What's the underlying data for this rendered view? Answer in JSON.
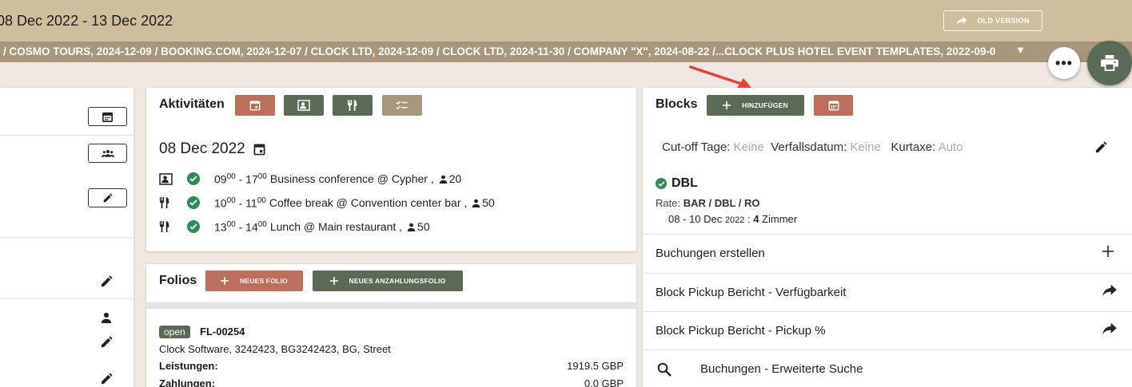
{
  "header": {
    "date_range": "08 Dec 2022 - 13 Dec 2022",
    "old_version_label": "OLD VERSION"
  },
  "breadcrumbs": "/  COSMO TOURS, 2024-12-09  /  BOOKING.COM, 2024-12-07  /  CLOCK LTD, 2024-12-09  /  CLOCK LTD, 2024-11-30  /  COMPANY \"X\", 2024-08-22  /...CLOCK PLUS HOTEL EVENT TEMPLATES, 2022-09-0",
  "fab": {
    "more_label": "•••"
  },
  "activities": {
    "title": "Aktivitäten",
    "date": "08 Dec 2022",
    "items": [
      {
        "kind_icon": "conference-icon",
        "start": "09",
        "start_min": "00",
        "end": "17",
        "end_min": "00",
        "text": "Business conference @ Cypher ,",
        "people": "20"
      },
      {
        "kind_icon": "restaurant-icon",
        "start": "10",
        "start_min": "00",
        "end": "11",
        "end_min": "00",
        "text": "Coffee break @ Convention center bar ,",
        "people": "50"
      },
      {
        "kind_icon": "restaurant-icon",
        "start": "13",
        "start_min": "00",
        "end": "14",
        "end_min": "00",
        "text": "Lunch @ Main restaurant ,",
        "people": "50"
      }
    ]
  },
  "folios": {
    "title": "Folios",
    "new_folio_label": "NEUES FOLIO",
    "new_deposit_folio_label": "NEUES ANZAHLUNGSFOLIO",
    "folio": {
      "status": "open",
      "id": "FL-00254",
      "address": "Clock Software, 3242423, BG3242423, BG, Street",
      "services_label": "Leistungen:",
      "services_value": "1919.5 GBP",
      "payments_label": "Zahlungen:",
      "payments_value": "0.0 GBP"
    }
  },
  "blocks": {
    "title": "Blocks",
    "add_label": "HINZUFÜGEN",
    "cutoff_label": "Cut-off Tage:",
    "cutoff_value": "Keine",
    "expiry_label": "Verfallsdatum:",
    "expiry_value": "Keine",
    "tax_label": "Kurtaxe:",
    "tax_value": "Auto",
    "block": {
      "name": "DBL",
      "rate_label": "Rate:",
      "rate_value": "BAR / DBL / RO",
      "dates": "08 - 10 Dec",
      "year": "2022",
      "sep": ":",
      "rooms": "4",
      "rooms_label": "Zimmer"
    },
    "actions": [
      {
        "label": "Buchungen erstellen",
        "icon": "plus-icon"
      },
      {
        "label": "Block Pickup Bericht - Verfügbarkeit",
        "icon": "share-arrow-icon"
      },
      {
        "label": "Block Pickup Bericht - Pickup %",
        "icon": "share-arrow-icon"
      },
      {
        "label": "Buchungen - Erweiterte Suche",
        "icon": "search-icon"
      }
    ]
  },
  "colors": {
    "header_bg": "#cfbe9c",
    "crumb_bg": "#a8977b",
    "accent_red": "#bd6f5c",
    "accent_green": "#5b6a55",
    "accent_tan": "#a8977b",
    "annotation_arrow": "#e8413d"
  }
}
